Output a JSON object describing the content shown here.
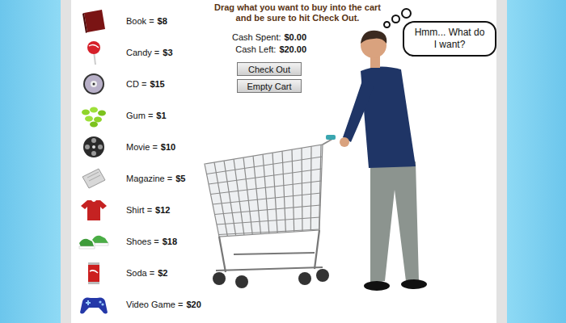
{
  "instructions": [
    "Drag what you want to buy into the cart",
    "and be sure to hit Check Out."
  ],
  "cash": [
    {
      "label": "Cash Spent:",
      "value": "$0.00"
    },
    {
      "label": "Cash Left:",
      "value": "$20.00"
    }
  ],
  "buttons": [
    "Check Out",
    "Empty Cart"
  ],
  "items": [
    {
      "label": "Book =",
      "price": "$8"
    },
    {
      "label": "Candy =",
      "price": "$3"
    },
    {
      "label": "CD =",
      "price": "$15"
    },
    {
      "label": "Gum =",
      "price": "$1"
    },
    {
      "label": "Movie =",
      "price": "$10"
    },
    {
      "label": "Magazine =",
      "price": "$5"
    },
    {
      "label": "Shirt =",
      "price": "$12"
    },
    {
      "label": "Shoes =",
      "price": "$18"
    },
    {
      "label": "Soda =",
      "price": "$2"
    },
    {
      "label": "Video Game =",
      "price": "$20"
    }
  ],
  "thought": [
    "Hmm... What do",
    "I want?"
  ]
}
